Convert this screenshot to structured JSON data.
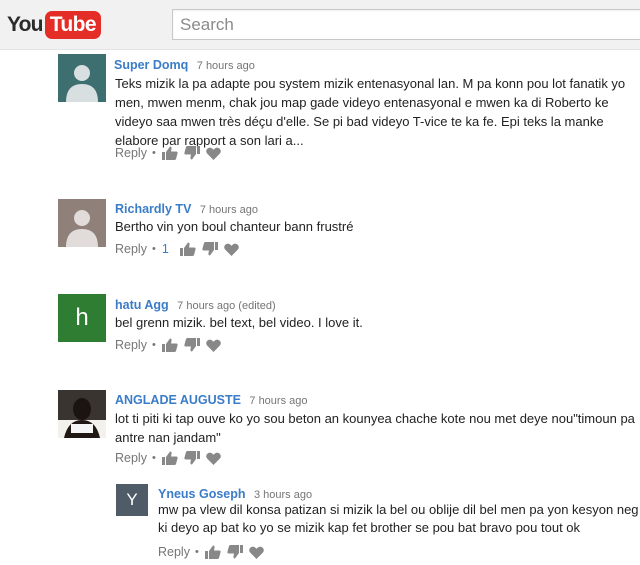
{
  "header": {
    "logo_you": "You",
    "logo_tube": "Tube",
    "search_placeholder": "Search"
  },
  "colors": {
    "brand_red": "#e52d27",
    "author_blue": "#3b7cc8",
    "avatar_green": "#2e7d32",
    "avatar_teal": "#3e6f70",
    "avatar_gray": "#4f5b66"
  },
  "actions": {
    "reply_label": "Reply",
    "separator": "•",
    "icons": [
      "thumbs-up-icon",
      "thumbs-down-icon",
      "heart-icon"
    ]
  },
  "comments": [
    {
      "author": "Super Domq",
      "time": "7 hours ago",
      "text": "Teks mizik la pa adapte pou system mizik entenasyonal lan. M pa konn pou lot fanatik yo men, mwen menm, chak jou map gade videyo entenasyonal e mwen ka di Roberto ke videyo saa mwen très déçu d'elle. Se pi bad videyo T-vice te ka fe. Epi teks la manke elabore par rapport a son lari a...",
      "avatar": "default-user-avatar"
    },
    {
      "author": "Richardly TV",
      "time": "7 hours ago",
      "text": "Bertho vin yon boul chanteur bann frustré",
      "reply_count": "1",
      "avatar": "default-user-avatar"
    },
    {
      "author": "hatu Agg",
      "time": "7 hours ago (edited)",
      "text": "bel grenn mizik.  bel text,  bel video.  I love it.",
      "avatar_letter": "h"
    },
    {
      "author": "ANGLADE AUGUSTE",
      "time": "7 hours ago",
      "text": "lot ti piti ki tap ouve ko yo sou beton an kounyea chache kote nou met deye nou\"timoun pa antre nan jandam\"",
      "avatar": "photo-avatar"
    },
    {
      "author": "Yneus Goseph",
      "time": "3 hours ago",
      "text": "mw pa vlew dil konsa patizan si mizik la bel ou oblije dil bel men pa yon kesyon neg ki deyo ap bat ko yo se mizik kap fet brother se pou bat bravo pou tout ok",
      "avatar_letter": "Y"
    }
  ]
}
